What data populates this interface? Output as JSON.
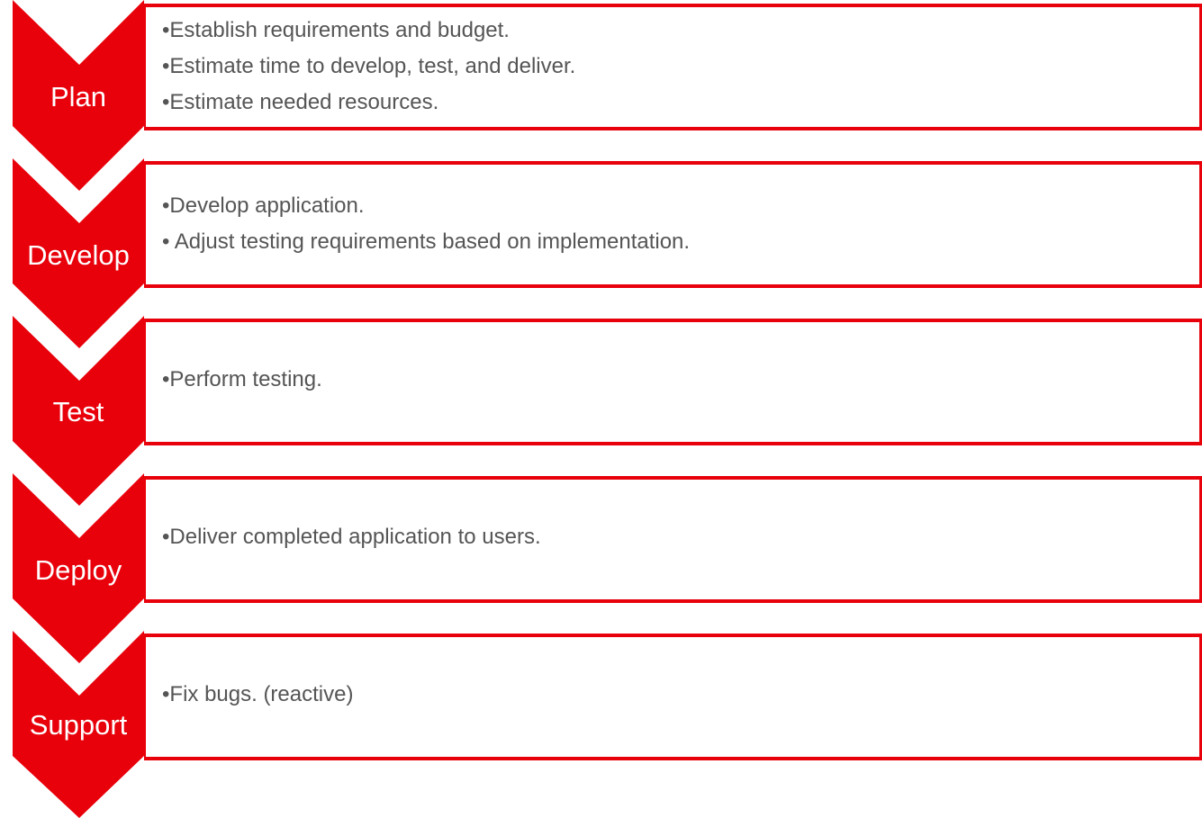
{
  "colors": {
    "accent": "#e8000b",
    "text": "#555555",
    "label_text": "#ffffff"
  },
  "steps": [
    {
      "label": "Plan",
      "bullets": [
        "•Establish requirements and budget.",
        "•Estimate time to develop, test, and deliver.",
        "•Estimate needed resources."
      ]
    },
    {
      "label": "Develop",
      "bullets": [
        "•Develop application.",
        "• Adjust testing requirements based on implementation."
      ]
    },
    {
      "label": "Test",
      "bullets": [
        "•Perform testing."
      ]
    },
    {
      "label": "Deploy",
      "bullets": [
        "•Deliver completed application to users."
      ]
    },
    {
      "label": "Support",
      "bullets": [
        "•Fix bugs. (reactive)"
      ]
    }
  ]
}
